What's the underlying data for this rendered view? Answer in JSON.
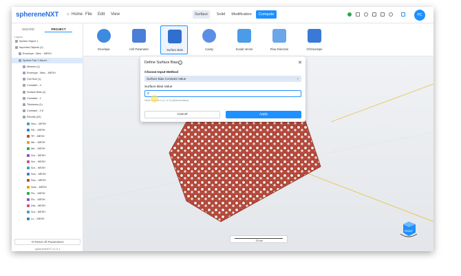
{
  "app": {
    "logo_text": "sphereneNXT",
    "version": "sphereneNXT v1.0.1"
  },
  "menu": {
    "home": "Home",
    "file": "File",
    "edit": "Edit",
    "view": "View"
  },
  "tabs": {
    "surface": "Surface",
    "solid": "Solid",
    "modification": "Modification",
    "compute": "Compute"
  },
  "user": {
    "initials": "PC"
  },
  "left_panel": {
    "tabs": [
      "WIZARD",
      "PROJECT"
    ],
    "layers_label": "Layers",
    "tree": [
      "Sphere Object 1",
      "Imported Objects (1)",
      "Envelope - Mes... MESH",
      "Sphere Part 1 Neum...",
      "Meshes (1)",
      "Envelope - Mes... MESH",
      "Cell Size (1)",
      "Constant - 4",
      "Surface Bias (1)",
      "Constant - 1",
      "Thickness (1)",
      "Constant - 0.5",
      "Results (20)",
      "Neo... MESH",
      "Fib... MESH",
      "TP... MESH",
      "Me... MESH",
      "Me... MESH",
      "Sur... MESH",
      "Sur... MESH",
      "Sur... MESH",
      "Sca... MESH",
      "Sca... MESH",
      "Scal... MESH",
      "Flo... MESH",
      "Flo... MESH",
      "Dfa... MESH",
      "Sur... MESH",
      "Lo... MESH"
    ],
    "reset_label": "Reset All Parameters"
  },
  "ribbon": [
    {
      "label": "Envelope",
      "color": "#3d8be0"
    },
    {
      "label": "Cell Parameter",
      "color": "#4a7fd8"
    },
    {
      "label": "Surface Bias",
      "color": "#2f6fcf"
    },
    {
      "label": "Cavity",
      "color": "#5b8fe6"
    },
    {
      "label": "Scalar Vector",
      "color": "#4a9be8"
    },
    {
      "label": "Flow Direction",
      "color": "#6aa6e8"
    },
    {
      "label": "Of Envelope",
      "color": "#3a7ad6"
    }
  ],
  "dialog": {
    "title": "Define Surface Bias",
    "method_label": "Choose Input Method",
    "method_value": "Surface Bias Constant Value",
    "value_label": "Surface Bias Value",
    "value": "0",
    "hint": "Value must be in [-1 to 1] (dimensionless)",
    "cancel": "Cancel",
    "apply": "Apply"
  },
  "scalebar": {
    "label": "20 mm"
  },
  "viewcube": {
    "face": "FRONT"
  }
}
